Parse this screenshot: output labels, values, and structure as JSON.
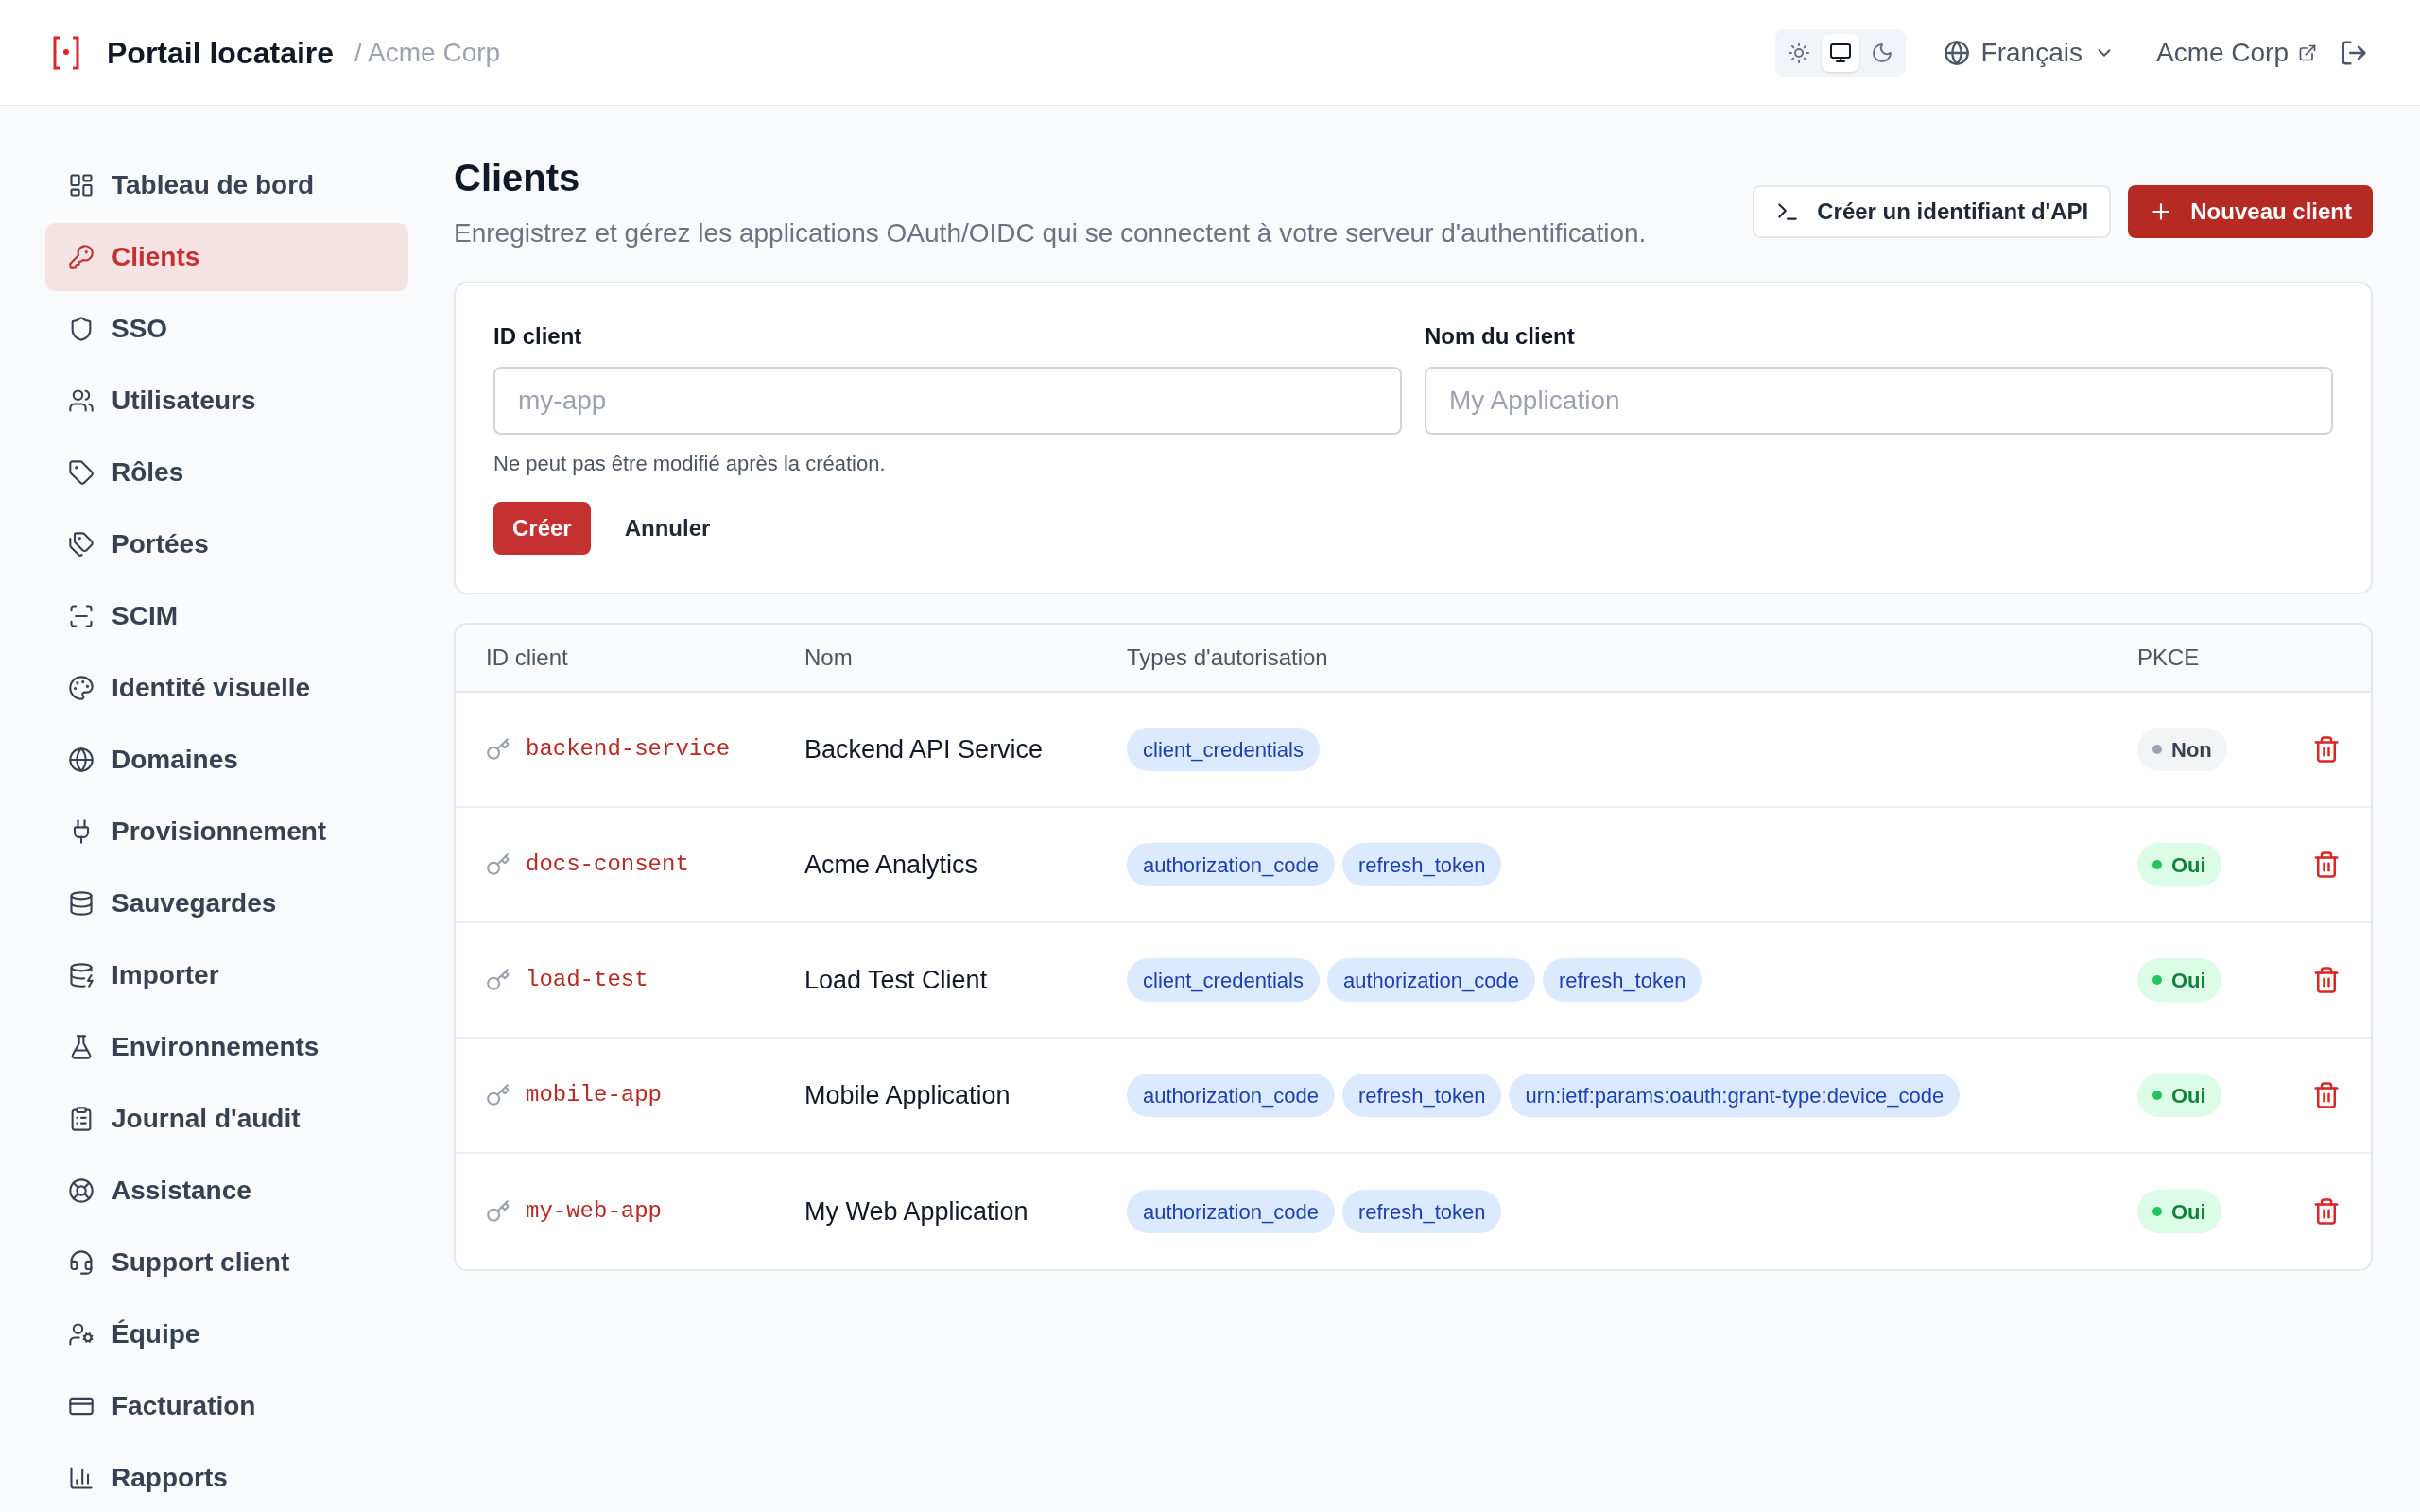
{
  "header": {
    "title": "Portail locataire",
    "breadcrumb": "/ Acme Corp",
    "themes": [
      {
        "kind": "light",
        "selected": false
      },
      {
        "kind": "system",
        "selected": true
      },
      {
        "kind": "dark",
        "selected": false
      }
    ],
    "language": "Français",
    "tenant_link": "Acme Corp"
  },
  "sidebar": {
    "items": [
      {
        "label": "Tableau de bord",
        "selected": false
      },
      {
        "label": "Clients",
        "selected": true
      },
      {
        "label": "SSO",
        "selected": false
      },
      {
        "label": "Utilisateurs",
        "selected": false
      },
      {
        "label": "Rôles",
        "selected": false
      },
      {
        "label": "Portées",
        "selected": false
      },
      {
        "label": "SCIM",
        "selected": false
      },
      {
        "label": "Identité visuelle",
        "selected": false
      },
      {
        "label": "Domaines",
        "selected": false
      },
      {
        "label": "Provisionnement",
        "selected": false
      },
      {
        "label": "Sauvegardes",
        "selected": false
      },
      {
        "label": "Importer",
        "selected": false
      },
      {
        "label": "Environnements",
        "selected": false
      },
      {
        "label": "Journal d'audit",
        "selected": false
      },
      {
        "label": "Assistance",
        "selected": false
      },
      {
        "label": "Support client",
        "selected": false
      },
      {
        "label": "Équipe",
        "selected": false
      },
      {
        "label": "Facturation",
        "selected": false
      },
      {
        "label": "Rapports",
        "selected": false
      }
    ]
  },
  "page": {
    "title": "Clients",
    "subtitle": "Enregistrez et gérez les applications OAuth/OIDC qui se connectent à votre serveur d'authentification.",
    "buttons": [
      "Créer un identifiant d'API",
      "Nouveau client"
    ]
  },
  "form": {
    "fields": [
      {
        "label": "ID client",
        "placeholder": "my-app"
      },
      {
        "label": "Nom du client",
        "placeholder": "My Application"
      }
    ],
    "hint": "Ne peut pas être modifié après la création.",
    "submit": "Créer",
    "cancel": "Annuler"
  },
  "table": {
    "columns": [
      "ID client",
      "Nom",
      "Types d'autorisation",
      "PKCE"
    ],
    "rows": [
      {
        "client_id": "backend-service",
        "name": "Backend API Service",
        "grant_types": [
          "client_credentials"
        ],
        "pkce": {
          "label": "Non",
          "on": false
        }
      },
      {
        "client_id": "docs-consent",
        "name": "Acme Analytics",
        "grant_types": [
          "authorization_code",
          "refresh_token"
        ],
        "pkce": {
          "label": "Oui",
          "on": true
        }
      },
      {
        "client_id": "load-test",
        "name": "Load Test Client",
        "grant_types": [
          "client_credentials",
          "authorization_code",
          "refresh_token"
        ],
        "pkce": {
          "label": "Oui",
          "on": true
        }
      },
      {
        "client_id": "mobile-app",
        "name": "Mobile Application",
        "grant_types": [
          "authorization_code",
          "refresh_token",
          "urn:ietf:params:oauth:grant-type:device_code"
        ],
        "pkce": {
          "label": "Oui",
          "on": true
        }
      },
      {
        "client_id": "my-web-app",
        "name": "My Web Application",
        "grant_types": [
          "authorization_code",
          "refresh_token"
        ],
        "pkce": {
          "label": "Oui",
          "on": true
        }
      }
    ]
  }
}
